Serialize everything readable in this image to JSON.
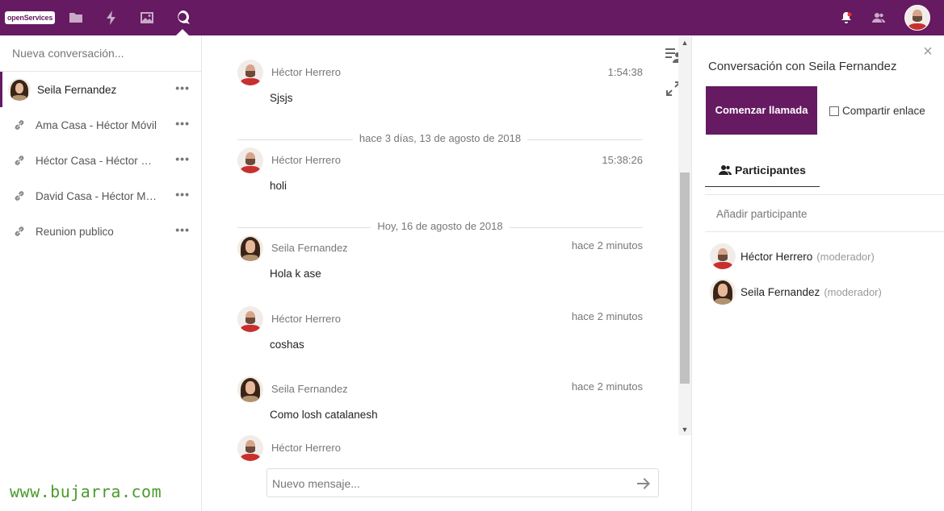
{
  "topbar": {
    "logo_text": "openServices",
    "nav": [
      {
        "icon": "folder-icon"
      },
      {
        "icon": "bolt-icon"
      },
      {
        "icon": "image-icon"
      },
      {
        "icon": "talk-icon",
        "active": true
      }
    ],
    "right_icons": [
      "bell-icon",
      "contacts-icon",
      "user-avatar"
    ]
  },
  "sidebar": {
    "new_conversation_placeholder": "Nueva conversación...",
    "conversations": [
      {
        "name": "Seila Fernandez",
        "type": "user",
        "active": true
      },
      {
        "name": "Ama Casa - Héctor Móvil",
        "type": "link"
      },
      {
        "name": "Héctor Casa - Héctor Móvil",
        "type": "link"
      },
      {
        "name": "David Casa - Héctor Móvil",
        "type": "link"
      },
      {
        "name": "Reunion publico",
        "type": "link"
      }
    ],
    "menu_label": "•••"
  },
  "watermark": "www.bujarra.com",
  "chat": {
    "messages": [
      {
        "author": "Héctor Herrero",
        "time": "1:54:38",
        "text": "Sjsjs",
        "avatar": "hector"
      },
      {
        "author": "Héctor Herrero",
        "time": "15:38:26",
        "text": "holi",
        "avatar": "hector"
      },
      {
        "author": "Seila Fernandez",
        "time": "hace 2 minutos",
        "text": "Hola k ase",
        "avatar": "seila"
      },
      {
        "author": "Héctor Herrero",
        "time": "hace 2 minutos",
        "text": "coshas",
        "avatar": "hector"
      },
      {
        "author": "Seila Fernandez",
        "time": "hace 2 minutos",
        "text": "Como losh catalanesh",
        "avatar": "seila"
      },
      {
        "author": "Héctor Herrero",
        "time": "",
        "text": "",
        "avatar": "hector"
      }
    ],
    "date_separators": [
      "hace 3 días, 13 de agosto de 2018",
      "Hoy, 16 de agosto de 2018"
    ],
    "composer_placeholder": "Nuevo mensaje..."
  },
  "panel": {
    "title": "Conversación con Seila Fernandez",
    "call_button": "Comenzar llamada",
    "share_link_label": "Compartir enlace",
    "tab_label": "Participantes",
    "add_participant_placeholder": "Añadir participante",
    "participants": [
      {
        "name": "Héctor Herrero",
        "role": "(moderador)",
        "avatar": "hector"
      },
      {
        "name": "Seila Fernandez",
        "role": "(moderador)",
        "avatar": "seila"
      }
    ]
  },
  "colors": {
    "brand": "#651a62",
    "watermark": "#4a9b2e"
  }
}
